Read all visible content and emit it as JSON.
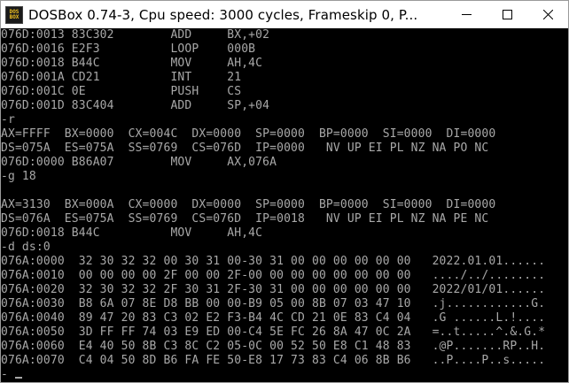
{
  "window": {
    "title": "DOSBox 0.74-3, Cpu speed:     3000 cycles, Frameskip  0, P...",
    "icon_text_top": "DOS",
    "icon_text_bottom": "BOX",
    "icons": {
      "app": "dosbox-app-icon",
      "minimize": "minimize-icon",
      "maximize": "maximize-icon",
      "close": "close-icon"
    }
  },
  "console": {
    "lines": [
      "076D:0013 83C302        ADD     BX,+02",
      "076D:0016 E2F3          LOOP    000B",
      "076D:0018 B44C          MOV     AH,4C",
      "076D:001A CD21          INT     21",
      "076D:001C 0E            PUSH    CS",
      "076D:001D 83C404        ADD     SP,+04",
      "-r",
      "AX=FFFF  BX=0000  CX=004C  DX=0000  SP=0000  BP=0000  SI=0000  DI=0000",
      "DS=075A  ES=075A  SS=0769  CS=076D  IP=0000   NV UP EI PL NZ NA PO NC",
      "076D:0000 B86A07        MOV     AX,076A",
      "-g 18",
      "",
      "AX=3130  BX=000A  CX=0000  DX=0000  SP=0000  BP=0000  SI=0000  DI=0000",
      "DS=076A  ES=075A  SS=0769  CS=076D  IP=0018   NV UP EI PL NZ NA PE NC",
      "076D:0018 B44C          MOV     AH,4C",
      "-d ds:0",
      "076A:0000  32 30 32 32 00 30 31 00-30 31 00 00 00 00 00 00   2022.01.01......",
      "076A:0010  00 00 00 00 2F 00 00 2F-00 00 00 00 00 00 00 00   ..../../........",
      "076A:0020  32 30 32 32 2F 30 31 2F-30 31 00 00 00 00 00 00   2022/01/01......",
      "076A:0030  B8 6A 07 8E D8 BB 00 00-B9 05 00 8B 07 03 47 10   .j............G.",
      "076A:0040  89 47 20 83 C3 02 E2 F3-B4 4C CD 21 0E 83 C4 04   .G ......L.!....",
      "076A:0050  3D FF FF 74 03 E9 ED 00-C4 5E FC 26 8A 47 0C 2A   =..t.....^.&.G.*",
      "076A:0060  E4 40 50 8B C3 8C C2 05-0C 00 52 50 E8 C1 48 83   .@P.......RP..H.",
      "076A:0070  C4 04 50 8D B6 FA FE 50-E8 17 73 83 C4 06 8B B6   ..P....P..s.....",
      "-"
    ]
  }
}
